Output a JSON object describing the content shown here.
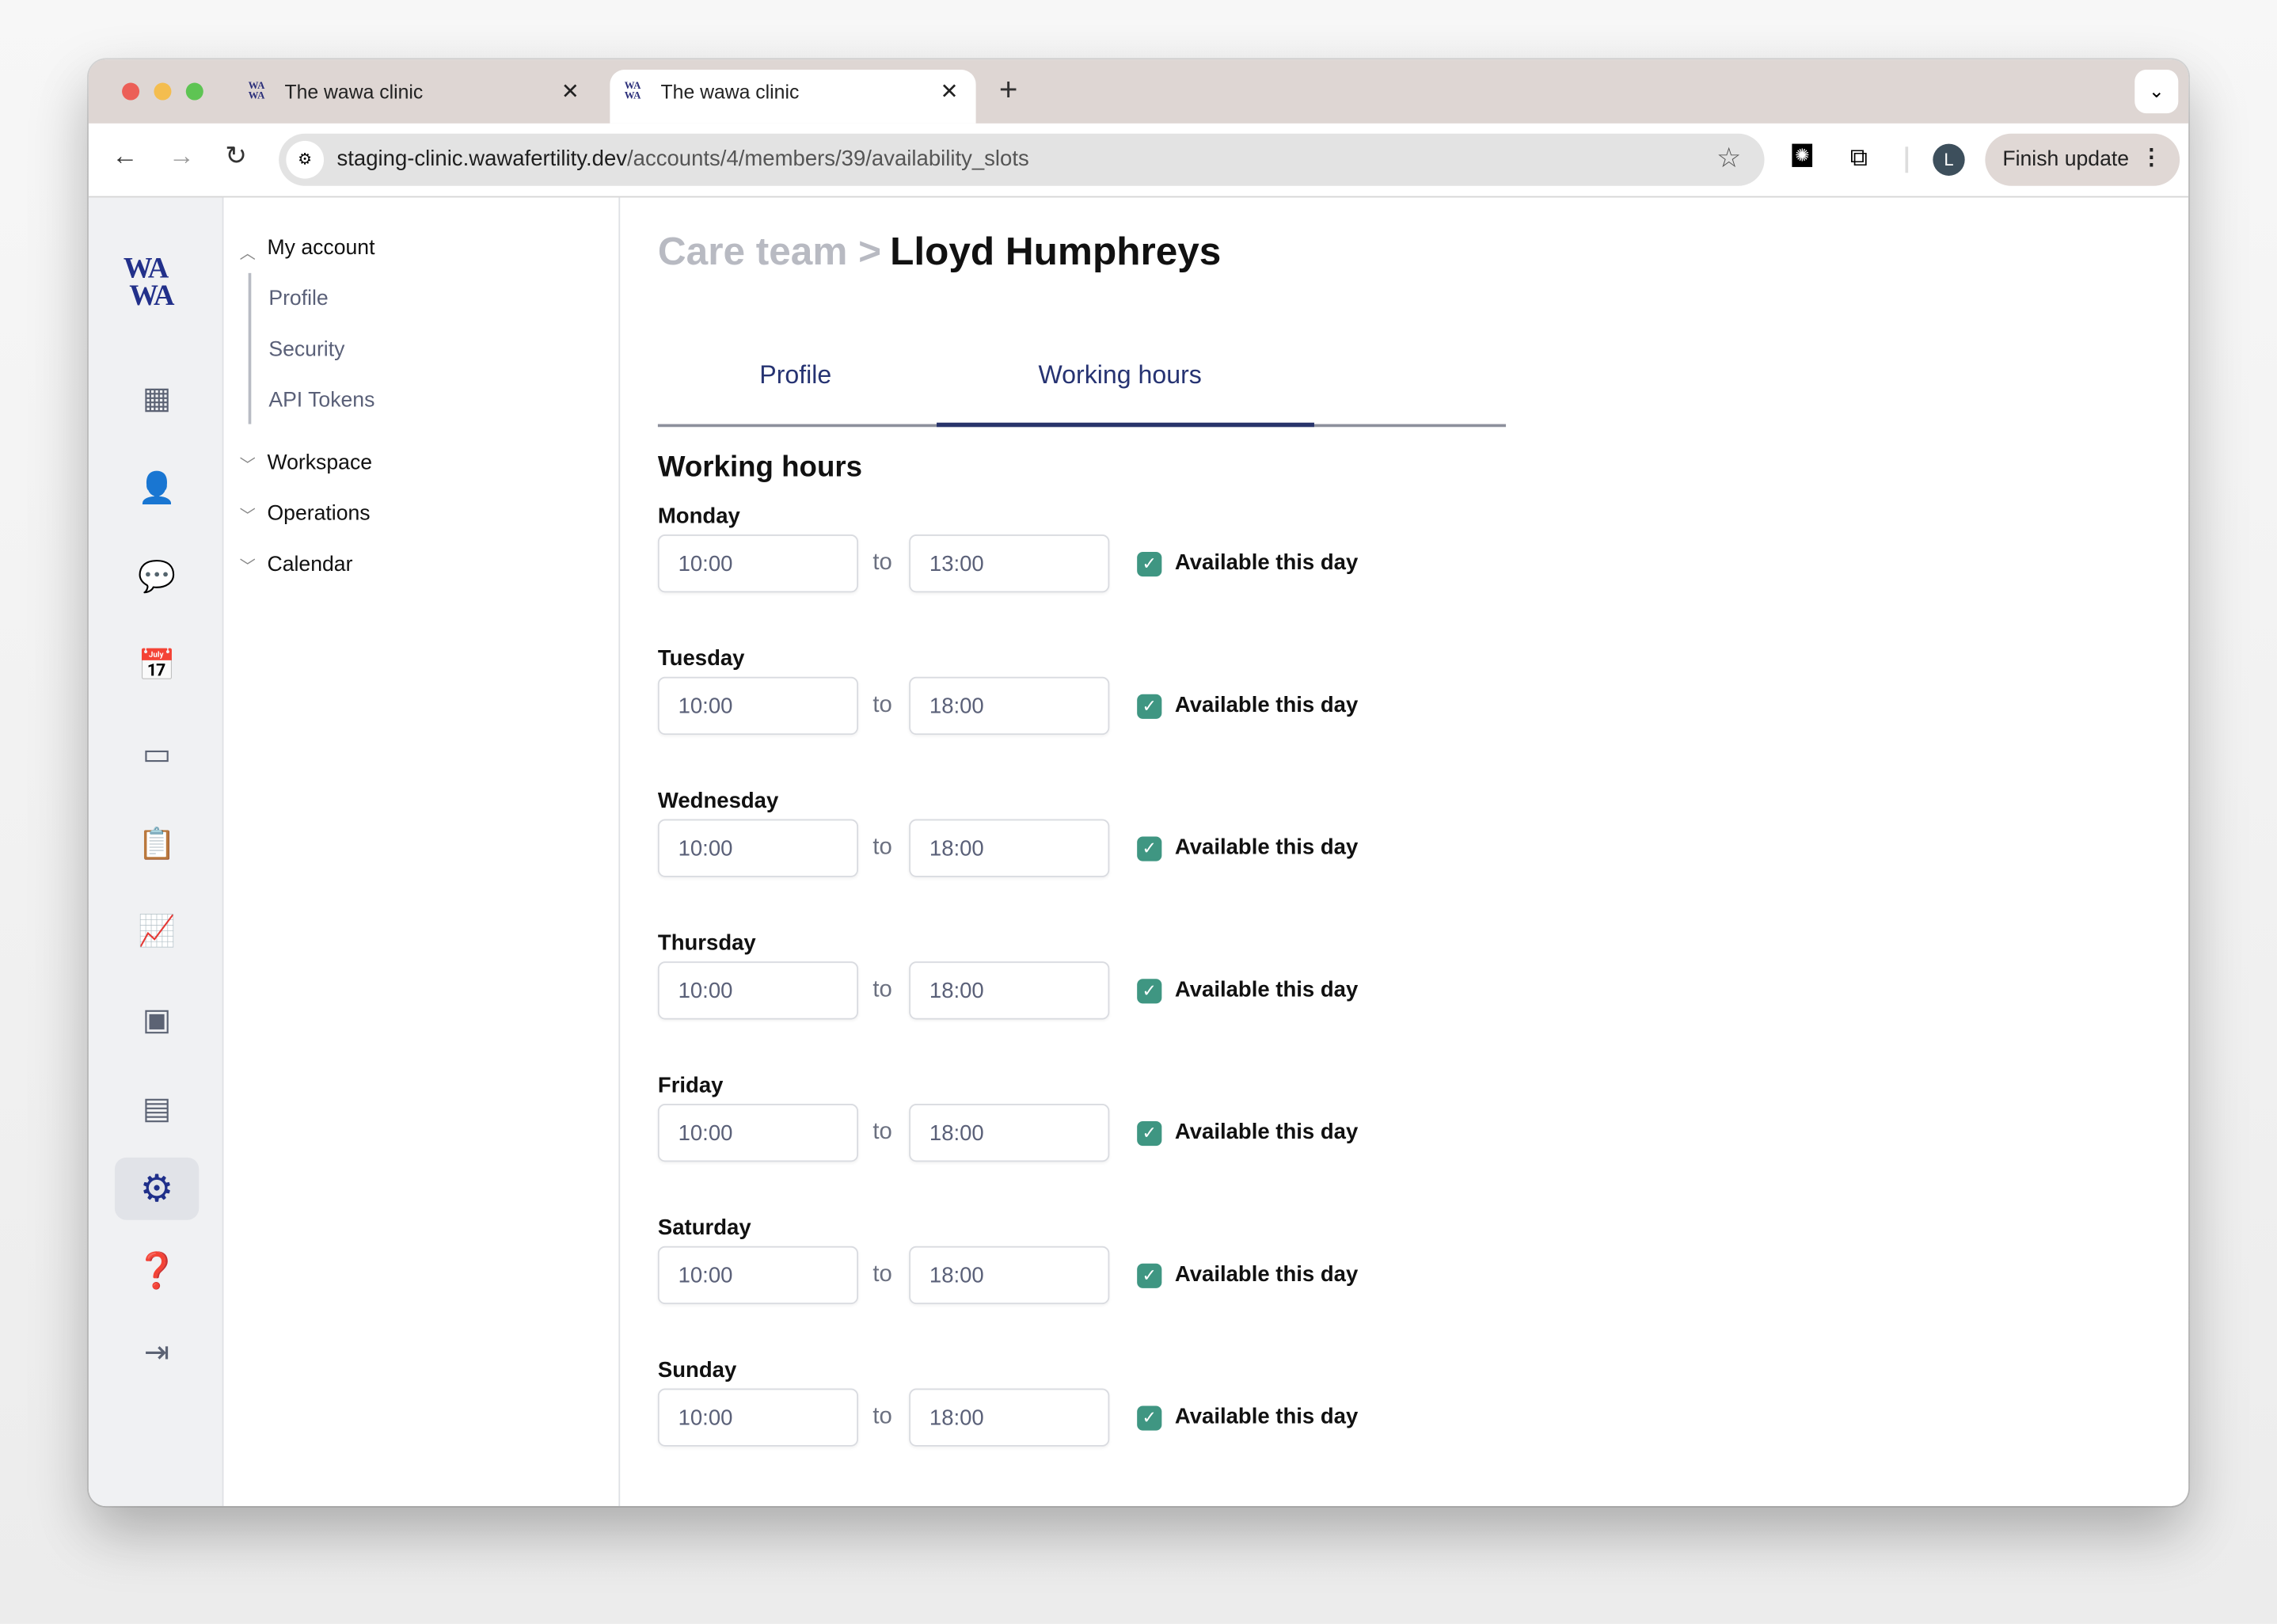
{
  "browser": {
    "tabs": [
      {
        "title": "The wawa clinic",
        "favicon": "WA WA"
      },
      {
        "title": "The wawa clinic",
        "favicon": "WA WA"
      }
    ],
    "url_host": "staging-clinic.wawafertility.dev",
    "url_path": "/accounts/4/members/39/availability_slots",
    "profile_initial": "L",
    "finish_update": "Finish update"
  },
  "logo": "WA WA",
  "rail_icons": [
    "dashboard-icon",
    "patients-icon",
    "messages-icon",
    "calendar-icon",
    "billing-icon",
    "tasks-icon",
    "analytics-icon",
    "contacts-icon",
    "monitoring-icon",
    "settings-icon",
    "help-icon",
    "logout-icon"
  ],
  "nav": {
    "my_account": "My account",
    "sub": [
      "Profile",
      "Security",
      "API Tokens"
    ],
    "workspace": "Workspace",
    "operations": "Operations",
    "calendar": "Calendar"
  },
  "breadcrumb": {
    "parent": "Care team >",
    "current": "Lloyd Humphreys"
  },
  "tabs": {
    "profile": "Profile",
    "working_hours": "Working hours",
    "active": "working_hours"
  },
  "section_title": "Working hours",
  "to_label": "to",
  "available_label": "Available this day",
  "days": [
    {
      "name": "Monday",
      "from": "10:00",
      "to": "13:00",
      "available": true
    },
    {
      "name": "Tuesday",
      "from": "10:00",
      "to": "18:00",
      "available": true
    },
    {
      "name": "Wednesday",
      "from": "10:00",
      "to": "18:00",
      "available": true
    },
    {
      "name": "Thursday",
      "from": "10:00",
      "to": "18:00",
      "available": true
    },
    {
      "name": "Friday",
      "from": "10:00",
      "to": "18:00",
      "available": true
    },
    {
      "name": "Saturday",
      "from": "10:00",
      "to": "18:00",
      "available": true
    },
    {
      "name": "Sunday",
      "from": "10:00",
      "to": "18:00",
      "available": true
    }
  ],
  "colors": {
    "accent": "#28346b",
    "check": "#3f9682",
    "tabstrip": "#ded6d3"
  }
}
